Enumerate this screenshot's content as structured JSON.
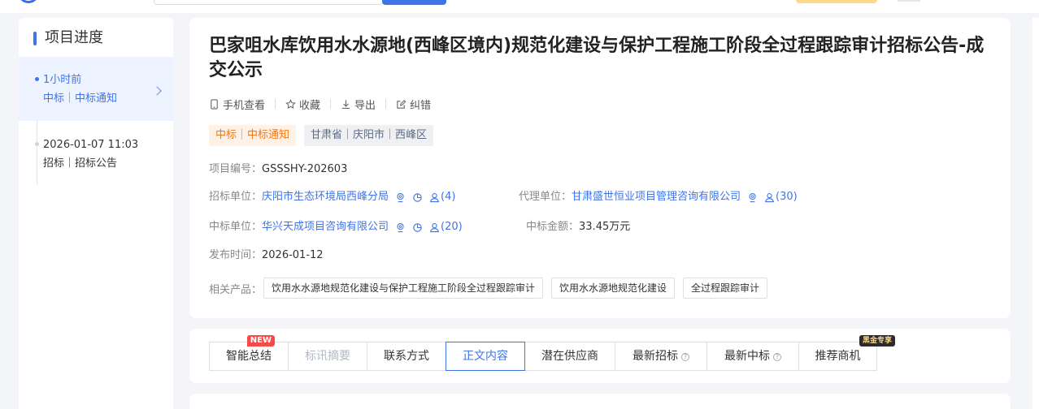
{
  "sidebar": {
    "title": "项目进度",
    "items": [
      {
        "time": "1小时前",
        "type": "中标｜中标通知",
        "active": true
      },
      {
        "time": "2026-01-07 11:03",
        "type": "招标｜招标公告",
        "active": false
      }
    ]
  },
  "notice": {
    "title": "巴家咀水库饮用水水源地(西峰区境内)规范化建设与保护工程施工阶段全过程跟踪审计招标公告-成交公示",
    "actions": {
      "mobile": "手机查看",
      "favorite": "收藏",
      "export": "导出",
      "correct": "纠错"
    },
    "tags": {
      "type": "中标｜中标通知",
      "region": "甘肃省｜庆阳市｜西峰区"
    },
    "fields": {
      "project_no_label": "项目编号：",
      "project_no": "GSSSHY-202603",
      "tenderer_label": "招标单位：",
      "tenderer": "庆阳市生态环境局西峰分局",
      "tenderer_contacts": "(4)",
      "agent_label": "代理单位：",
      "agent": "甘肃盛世恒业项目管理咨询有限公司",
      "agent_contacts": "(30)",
      "winner_label": "中标单位：",
      "winner": "华兴天成项目咨询有限公司",
      "winner_contacts": "(20)",
      "amount_label": "中标金额：",
      "amount": "33.45万元",
      "publish_label": "发布时间：",
      "publish_date": "2026-01-12",
      "products_label": "相关产品："
    },
    "products": [
      "饮用水水源地规范化建设与保护工程施工阶段全过程跟踪审计",
      "饮用水水源地规范化建设",
      "全过程跟踪审计"
    ]
  },
  "tabs": [
    {
      "label": "智能总结",
      "badge": "NEW"
    },
    {
      "label": "标讯摘要",
      "disabled": true
    },
    {
      "label": "联系方式"
    },
    {
      "label": "正文内容",
      "active": true
    },
    {
      "label": "潜在供应商"
    },
    {
      "label": "最新招标",
      "help": "?"
    },
    {
      "label": "最新中标",
      "help": "?"
    },
    {
      "label": "推荐商机",
      "badge": "黑金专享"
    }
  ],
  "colors": {
    "accent": "#3f74e8",
    "tag_orange": "#f07a16",
    "badge_new": "#f54b4b"
  }
}
